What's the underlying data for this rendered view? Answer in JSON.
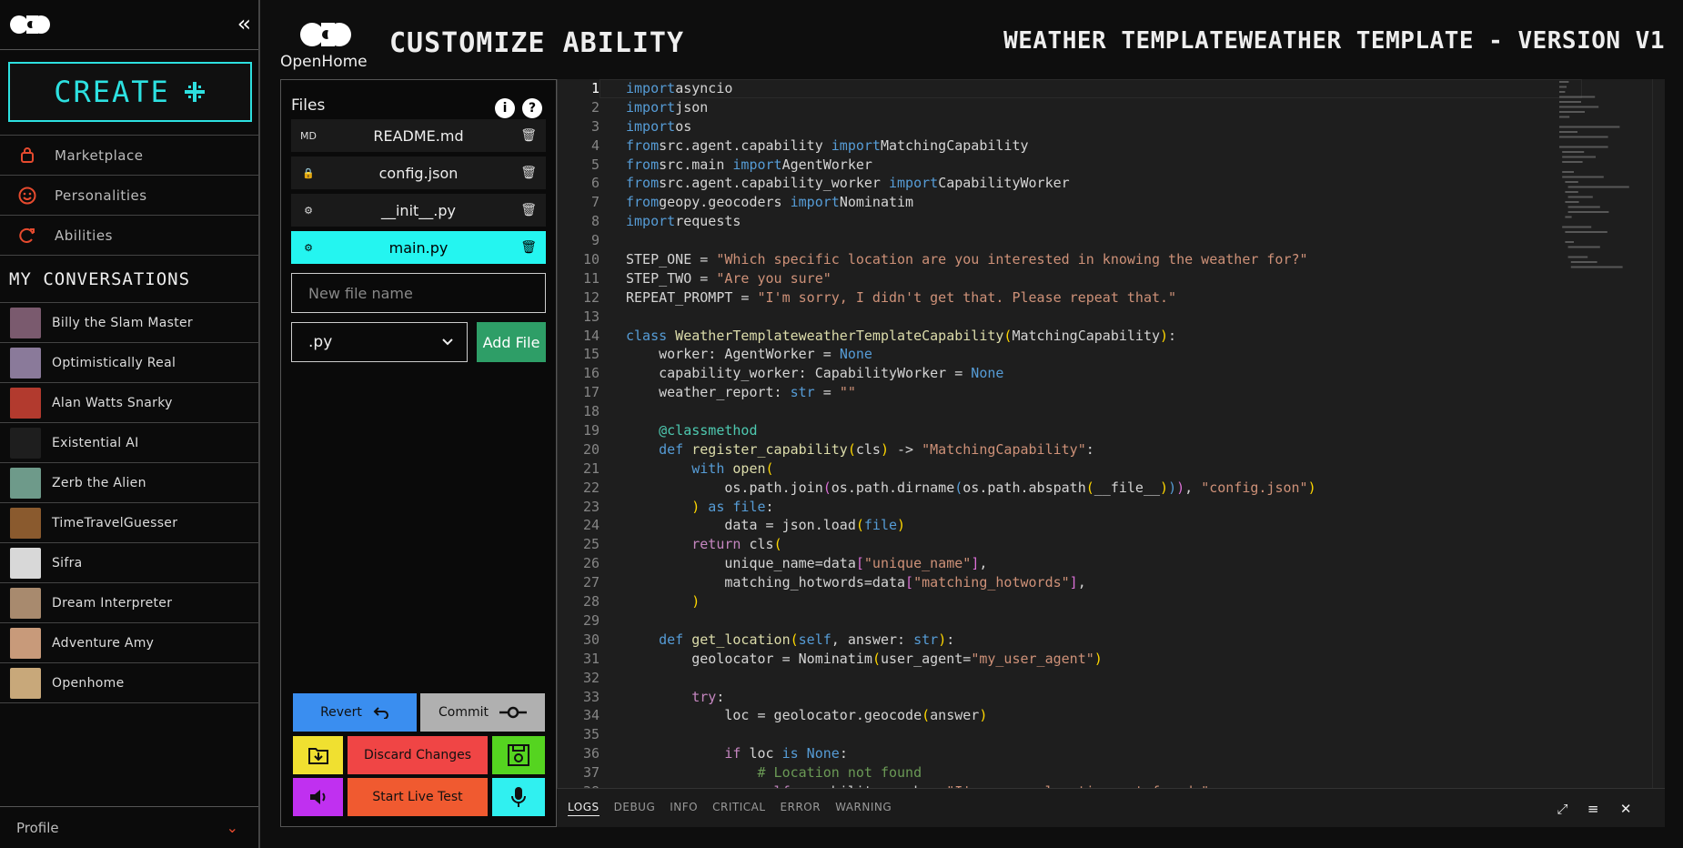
{
  "sidebar": {
    "create_label": "CREATE",
    "nav": [
      {
        "label": "Marketplace",
        "icon": "shopping-bag-icon"
      },
      {
        "label": "Personalities",
        "icon": "smile-icon"
      },
      {
        "label": "Abilities",
        "icon": "refresh-icon"
      }
    ],
    "conversations_title": "MY CONVERSATIONS",
    "conversations": [
      {
        "name": "Billy the Slam Master",
        "color": "#7a5a6e"
      },
      {
        "name": "Optimistically Real",
        "color": "#8a7a9a"
      },
      {
        "name": "Alan Watts Snarky",
        "color": "#b23a2e"
      },
      {
        "name": "Existential AI",
        "color": "#1e1e1e"
      },
      {
        "name": "Zerb the Alien",
        "color": "#6e9a8a"
      },
      {
        "name": "TimeTravelGuesser",
        "color": "#8a5a2e"
      },
      {
        "name": "Sifra",
        "color": "#d8d8d8"
      },
      {
        "name": "Dream Interpreter",
        "color": "#a88a6e"
      },
      {
        "name": "Adventure Amy",
        "color": "#c89a7a"
      },
      {
        "name": "Openhome",
        "color": "#c8a87a"
      }
    ],
    "profile_label": "Profile"
  },
  "header": {
    "brand": "OpenHome",
    "page_title": "CUSTOMIZE ABILITY",
    "ability_title": "WEATHER TEMPLATEWEATHER TEMPLATE - VERSION V1"
  },
  "files": {
    "title": "Files",
    "list": [
      {
        "name": "README.md",
        "icon": "markdown-file-icon",
        "active": false
      },
      {
        "name": "config.json",
        "icon": "lock-file-icon",
        "active": false
      },
      {
        "name": "__init__.py",
        "icon": "python-icon",
        "active": false
      },
      {
        "name": "main.py",
        "icon": "python-icon",
        "active": true
      }
    ],
    "new_file_placeholder": "New file name",
    "extension": ".py",
    "add_file_label": "Add File",
    "revert_label": "Revert",
    "commit_label": "Commit",
    "discard_label": "Discard Changes",
    "live_test_label": "Start Live Test"
  },
  "editor": {
    "current_line": 1,
    "lines": [
      [
        [
          "kw",
          "import"
        ],
        [
          "",
          "asyncio"
        ]
      ],
      [
        [
          "kw",
          "import"
        ],
        [
          "",
          "json"
        ]
      ],
      [
        [
          "kw",
          "import"
        ],
        [
          "",
          "os"
        ]
      ],
      [
        [
          "kw",
          "from"
        ],
        [
          "",
          "src.agent.capability "
        ],
        [
          "kw",
          "import"
        ],
        [
          "",
          "MatchingCapability"
        ]
      ],
      [
        [
          "kw",
          "from"
        ],
        [
          "",
          "src.main "
        ],
        [
          "kw",
          "import"
        ],
        [
          "",
          "AgentWorker"
        ]
      ],
      [
        [
          "kw",
          "from"
        ],
        [
          "",
          "src.agent.capability_worker "
        ],
        [
          "kw",
          "import"
        ],
        [
          "",
          "CapabilityWorker"
        ]
      ],
      [
        [
          "kw",
          "from"
        ],
        [
          "",
          "geopy.geocoders "
        ],
        [
          "kw",
          "import"
        ],
        [
          "",
          "Nominatim"
        ]
      ],
      [
        [
          "kw",
          "import"
        ],
        [
          "",
          "requests"
        ]
      ],
      [],
      [
        [
          "",
          "STEP_ONE = "
        ],
        [
          "st",
          "\"Which specific location are you interested in knowing the weather for?\""
        ]
      ],
      [
        [
          "",
          "STEP_TWO = "
        ],
        [
          "st",
          "\"Are you sure\""
        ]
      ],
      [
        [
          "",
          "REPEAT_PROMPT = "
        ],
        [
          "st",
          "\"I'm sorry, I didn't get that. Please repeat that.\""
        ]
      ],
      [],
      [
        [
          "kw",
          "class"
        ],
        [
          "fn",
          " WeatherTemplateweatherTemplateCapability"
        ],
        [
          "br",
          "("
        ],
        [
          "",
          "MatchingCapability"
        ],
        [
          "br",
          ")"
        ],
        [
          "",
          ":"
        ]
      ],
      [
        [
          "",
          "    worker: AgentWorker = "
        ],
        [
          "kw",
          "None"
        ]
      ],
      [
        [
          "",
          "    capability_worker: CapabilityWorker = "
        ],
        [
          "kw",
          "None"
        ]
      ],
      [
        [
          "",
          "    weather_report: "
        ],
        [
          "kw",
          "str"
        ],
        [
          "",
          " = "
        ],
        [
          "st",
          "\"\""
        ]
      ],
      [],
      [
        [
          "dec",
          "    @classmethod"
        ]
      ],
      [
        [
          "kw",
          "    def"
        ],
        [
          "fn",
          " register_capability"
        ],
        [
          "br",
          "("
        ],
        [
          "",
          "cls"
        ],
        [
          "br",
          ")"
        ],
        [
          "",
          " -> "
        ],
        [
          "st",
          "\"MatchingCapability\""
        ],
        [
          "",
          ":"
        ]
      ],
      [
        [
          "kw",
          "        with"
        ],
        [
          "fn",
          " open"
        ],
        [
          "br",
          "("
        ]
      ],
      [
        [
          "",
          "            os.path.join"
        ],
        [
          "bp",
          "("
        ],
        [
          "",
          "os.path.dirname"
        ],
        [
          "kw",
          "("
        ],
        [
          "",
          "os.path.abspath"
        ],
        [
          "br",
          "("
        ],
        [
          "",
          "__file__"
        ],
        [
          "br",
          ")"
        ],
        [
          "kw",
          ")"
        ],
        [
          "bp",
          ")"
        ],
        [
          "",
          ", "
        ],
        [
          "st",
          "\"config.json\""
        ],
        [
          "br",
          ")"
        ]
      ],
      [
        [
          "br",
          "        )"
        ],
        [
          "kw",
          " as"
        ],
        [
          "kw",
          " file"
        ],
        [
          "",
          ":"
        ]
      ],
      [
        [
          "",
          "            data = json.load"
        ],
        [
          "br",
          "("
        ],
        [
          "kw",
          "file"
        ],
        [
          "br",
          ")"
        ]
      ],
      [
        [
          "kp",
          "        return"
        ],
        [
          "",
          " cls"
        ],
        [
          "br",
          "("
        ]
      ],
      [
        [
          "",
          "            unique_name=data"
        ],
        [
          "bp",
          "["
        ],
        [
          "st",
          "\"unique_name\""
        ],
        [
          "bp",
          "]"
        ],
        [
          "",
          ","
        ]
      ],
      [
        [
          "",
          "            matching_hotwords=data"
        ],
        [
          "bp",
          "["
        ],
        [
          "st",
          "\"matching_hotwords\""
        ],
        [
          "bp",
          "]"
        ],
        [
          "",
          ","
        ]
      ],
      [
        [
          "br",
          "        )"
        ]
      ],
      [],
      [
        [
          "kw",
          "    def"
        ],
        [
          "fn",
          " get_location"
        ],
        [
          "br",
          "("
        ],
        [
          "kw",
          "self"
        ],
        [
          "",
          ", answer: "
        ],
        [
          "kw",
          "str"
        ],
        [
          "br",
          ")"
        ],
        [
          "",
          ":"
        ]
      ],
      [
        [
          "",
          "        geolocator = Nominatim"
        ],
        [
          "br",
          "("
        ],
        [
          "",
          "user_agent="
        ],
        [
          "st",
          "\"my_user_agent\""
        ],
        [
          "br",
          ")"
        ]
      ],
      [],
      [
        [
          "kp",
          "        try"
        ],
        [
          "",
          ":"
        ]
      ],
      [
        [
          "",
          "            loc = geolocator.geocode"
        ],
        [
          "br",
          "("
        ],
        [
          "",
          "answer"
        ],
        [
          "br",
          ")"
        ]
      ],
      [],
      [
        [
          "kp",
          "            if"
        ],
        [
          "",
          " loc "
        ],
        [
          "kw",
          "is"
        ],
        [
          "kw",
          " None"
        ],
        [
          "",
          ":"
        ]
      ],
      [
        [
          "cm",
          "                # Location not found"
        ]
      ],
      [
        [
          "kp",
          "                self"
        ],
        [
          "",
          ".capability_worker."
        ],
        [
          "st",
          "\"I'm sorry, location not found.\""
        ]
      ]
    ]
  },
  "logs": {
    "tabs": [
      "LOGS",
      "DEBUG",
      "INFO",
      "CRITICAL",
      "ERROR",
      "WARNING"
    ],
    "active": "LOGS"
  },
  "colors": {
    "accent_cyan": "#24f5f0",
    "accent_orange": "#e64a2e",
    "add_green": "#2e9e67",
    "revert_blue": "#3a8ef0",
    "commit_gray": "#b0b0b0",
    "folder_yellow": "#f0e030",
    "discard_red": "#f04545",
    "save_green": "#55d420",
    "speaker_purple": "#c030f0",
    "live_orange": "#f05a30",
    "mic_cyan": "#30f0f0"
  }
}
